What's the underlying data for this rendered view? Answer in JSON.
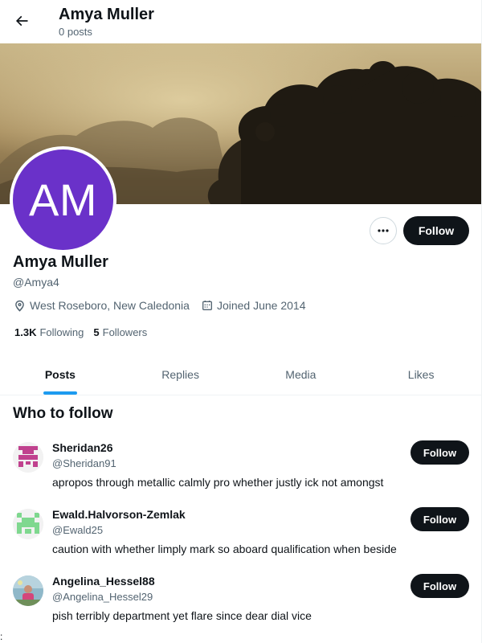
{
  "header": {
    "title": "Amya Muller",
    "subtitle": "0 posts",
    "back_icon": "arrow-left-icon"
  },
  "profile": {
    "avatar_initials": "AM",
    "avatar_color": "#6a31c9",
    "name": "Amya Muller",
    "handle": "@Amya4",
    "location": "West Roseboro, New Caledonia",
    "joined": "Joined June 2014",
    "following_count": "1.3K",
    "following_label": "Following",
    "followers_count": "5",
    "followers_label": "Followers",
    "follow_button": "Follow",
    "more_icon": "more-dots-icon"
  },
  "tabs": [
    {
      "label": "Posts",
      "active": true
    },
    {
      "label": "Replies",
      "active": false
    },
    {
      "label": "Media",
      "active": false
    },
    {
      "label": "Likes",
      "active": false
    }
  ],
  "who_to_follow": {
    "title": "Who to follow",
    "items": [
      {
        "name": "Sheridan26",
        "handle": "@Sheridan91",
        "bio": "apropos through metallic calmly pro whether justly ick not amongst",
        "button": "Follow"
      },
      {
        "name": "Ewald.Halvorson-Zemlak",
        "handle": "@Ewald25",
        "bio": "caution with whether limply mark so aboard qualification when beside",
        "button": "Follow"
      },
      {
        "name": "Angelina_Hessel88",
        "handle": "@Angelina_Hessel29",
        "bio": "pish terribly department yet flare since dear dial vice",
        "button": "Follow"
      }
    ]
  },
  "colors": {
    "accent": "#1d9bf0",
    "button_dark": "#0f1419",
    "muted_text": "#536471"
  },
  "footer_mark": ":"
}
